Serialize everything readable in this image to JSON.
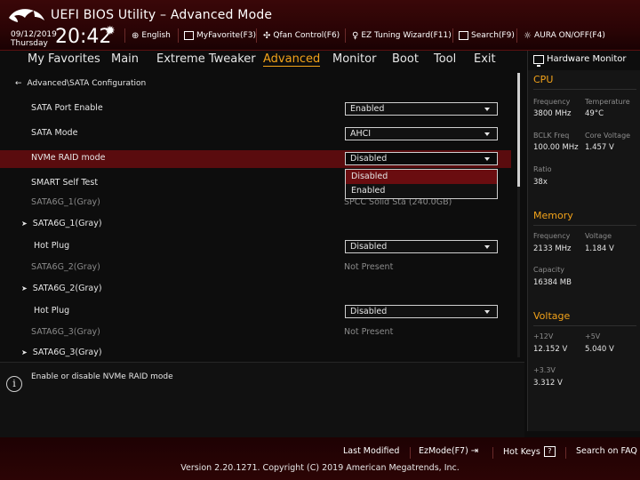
{
  "header": {
    "title": "UEFI BIOS Utility – Advanced Mode",
    "date": "09/12/2019",
    "day": "Thursday",
    "time": "20:42",
    "items": [
      {
        "label": "English",
        "icon": "globe-icon"
      },
      {
        "label": "MyFavorite(F3)",
        "icon": "favorite-icon"
      },
      {
        "label": "Qfan Control(F6)",
        "icon": "fan-icon"
      },
      {
        "label": "EZ Tuning Wizard(F11)",
        "icon": "lightbulb-icon"
      },
      {
        "label": "Search(F9)",
        "icon": "search-icon"
      },
      {
        "label": "AURA ON/OFF(F4)",
        "icon": "aura-icon"
      }
    ]
  },
  "nav": {
    "tabs": [
      "My Favorites",
      "Main",
      "Extreme Tweaker",
      "Advanced",
      "Monitor",
      "Boot",
      "Tool",
      "Exit"
    ],
    "active": "Advanced"
  },
  "main": {
    "breadcrumb": "Advanced\\SATA Configuration",
    "rows": [
      {
        "label": "SATA Port Enable",
        "value": "Enabled"
      },
      {
        "label": "SATA Mode",
        "value": "AHCI"
      },
      {
        "label": "NVMe RAID mode",
        "value": "Disabled"
      },
      {
        "label": "SMART Self Test",
        "value": ""
      },
      {
        "label": "SATA6G_1(Gray)",
        "value": "SPCC Solid Sta (240.0GB)"
      },
      {
        "label": "SATA6G_1(Gray)",
        "value": ""
      },
      {
        "label": "Hot Plug",
        "value": "Disabled"
      },
      {
        "label": "SATA6G_2(Gray)",
        "value": "Not Present"
      },
      {
        "label": "SATA6G_2(Gray)",
        "value": ""
      },
      {
        "label": "Hot Plug",
        "value": "Disabled"
      },
      {
        "label": "SATA6G_3(Gray)",
        "value": "Not Present"
      },
      {
        "label": "SATA6G_3(Gray)",
        "value": ""
      }
    ],
    "dropdown_options": [
      "Disabled",
      "Enabled"
    ]
  },
  "help": {
    "text": "Enable or disable NVMe RAID mode"
  },
  "hw": {
    "title": "Hardware Monitor",
    "cpu": {
      "title": "CPU",
      "frequency_label": "Frequency",
      "frequency": "3800 MHz",
      "temperature_label": "Temperature",
      "temperature": "49°C",
      "bclk_label": "BCLK Freq",
      "bclk": "100.00 MHz",
      "core_voltage_label": "Core Voltage",
      "core_voltage": "1.457 V",
      "ratio_label": "Ratio",
      "ratio": "38x"
    },
    "memory": {
      "title": "Memory",
      "frequency_label": "Frequency",
      "frequency": "2133 MHz",
      "voltage_label": "Voltage",
      "voltage": "1.184 V",
      "capacity_label": "Capacity",
      "capacity": "16384 MB"
    },
    "voltage": {
      "title": "Voltage",
      "v12_label": "+12V",
      "v12": "12.152 V",
      "v5_label": "+5V",
      "v5": "5.040 V",
      "v33_label": "+3.3V",
      "v33": "3.312 V"
    }
  },
  "footer": {
    "last_modified": "Last Modified",
    "ezmode": "EzMode(F7)",
    "hotkeys": "Hot Keys",
    "hotkeys_key": "?",
    "search_faq": "Search on FAQ",
    "copyright": "Version 2.20.1271. Copyright (C) 2019 American Megatrends, Inc."
  },
  "colors": {
    "accent": "#f3a31a",
    "header_bg": "#2a0405",
    "highlight": "#5a0c0e"
  }
}
